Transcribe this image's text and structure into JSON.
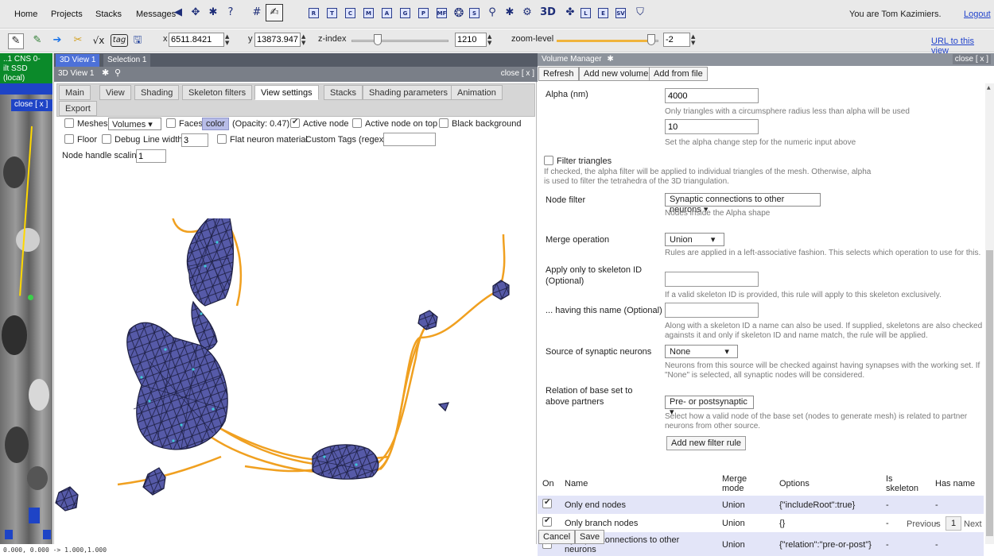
{
  "menu": {
    "items": [
      "Home",
      "Projects",
      "Stacks",
      "Messages"
    ],
    "user_text": "You are Tom Kazimiers.",
    "logout": "Logout"
  },
  "toolbar_icons": [
    "back-icon",
    "navigate-icon",
    "settings-icon",
    "help-icon",
    "grid-icon",
    "tracing-tool-icon"
  ],
  "toolbar_letter_icons": [
    "R",
    "T",
    "C",
    "M",
    "A",
    "G",
    "P",
    "MF",
    "⌘",
    "S",
    "⌕",
    "✱",
    "⚙",
    "3D",
    "⌘",
    "L",
    "E",
    "SV",
    "◇"
  ],
  "toolbar2": {
    "x_label": "x",
    "x_value": "6511.8421",
    "y_label": "y",
    "y_value": "13873.947",
    "z_index_label": "z-index",
    "z_value": "1210",
    "zoom_label": "zoom-level",
    "zoom_value": "-2",
    "url_link": "URL to this view",
    "tag_label": "tag",
    "sqrt_label": "√x"
  },
  "left_strip": {
    "header_line1": "..1 CNS 0-",
    "header_line2": "ilt SSD",
    "header_line3": "(local)",
    "close": "close [ x ]"
  },
  "panel3d": {
    "tabs": [
      "3D View 1",
      "Selection 1"
    ],
    "title": "3D View 1",
    "close": "close [ x ]",
    "view_tabs": [
      "Main",
      "View",
      "Shading",
      "Skeleton filters",
      "View settings",
      "Stacks",
      "Shading parameters",
      "Animation",
      "Export"
    ],
    "active_tab": "View settings",
    "options": {
      "meshes": "Meshes",
      "volumes": "Volumes",
      "faces": "Faces",
      "color": "color",
      "opacity": "(Opacity: 0.47)",
      "active_node": "Active node",
      "active_node_on_top": "Active node on top",
      "black_background": "Black background",
      "floor": "Floor",
      "debug": "Debug",
      "line_width_label": "Line width",
      "line_width_value": "3",
      "flat_neuron_material": "Flat neuron material",
      "custom_tags": "Custom Tags (regex):",
      "node_handle_scaling": "Node handle scaling",
      "node_handle_value": "1"
    },
    "colors": {
      "mesh": "#4a4f9a",
      "mesh_edge": "#1c1e40",
      "skeleton": "#f0a020",
      "synapse": "#3fc8d8"
    }
  },
  "volume_manager": {
    "title": "Volume Manager",
    "close": "close [ x ]",
    "buttons": {
      "refresh": "Refresh",
      "add_volume": "Add new volume",
      "add_file": "Add from file"
    },
    "alpha_label": "Alpha (nm)",
    "alpha_value": "4000",
    "alpha_help": "Only triangles with a circumsphere radius less than alpha will be used",
    "alpha_step_value": "10",
    "alpha_step_help": "Set the alpha change step for the numeric input above",
    "filter_triangles": "Filter triangles",
    "filter_triangles_help": "If checked, the alpha filter will be applied to individual triangles of the mesh. Otherwise, alpha is used to filter the tetrahedra of the 3D triangulation.",
    "node_filter_label": "Node filter",
    "node_filter_value": "Synaptic connections to other neurons",
    "node_filter_help": "Nodes inside the Alpha shape",
    "merge_label": "Merge operation",
    "merge_value": "Union",
    "merge_help": "Rules are applied in a left-associative fashion. This selects which operation to use for this.",
    "skeleton_id_label": "Apply only to skeleton ID (Optional)",
    "skeleton_id_help": "If a valid skeleton ID is provided, this rule will apply to this skeleton exclusively.",
    "name_label": "... having this name (Optional)",
    "name_help": "Along with a skeleton ID a name can also be used. If supplied, skeletons are also checked againsts it and only if skeleton ID and name match, the rule will be applied.",
    "source_label": "Source of synaptic neurons",
    "source_value": "None",
    "source_help": "Neurons from this source will be checked against having synapses with the working set. If \"None\" is selected, all synaptic nodes will be considered.",
    "relation_label": "Relation of base set to above partners",
    "relation_value": "Pre- or postsynaptic",
    "relation_help": "Select how a valid node of the base set (nodes to generate mesh) is related to partner neurons from other source.",
    "add_rule": "Add new filter rule",
    "table": {
      "headers": [
        "On",
        "Name",
        "Merge mode",
        "Options",
        "Is skeleton",
        "Has name"
      ],
      "rows": [
        {
          "name": "Only end nodes",
          "merge": "Union",
          "options": "{\"includeRoot\":true}",
          "is_skeleton": "-",
          "has_name": "-"
        },
        {
          "name": "Only branch nodes",
          "merge": "Union",
          "options": "{}",
          "is_skeleton": "-",
          "has_name": "-"
        },
        {
          "name": "Synaptic connections to other neurons",
          "merge": "Union",
          "options": "{\"relation\":\"pre-or-post\"}",
          "is_skeleton": "-",
          "has_name": "-"
        }
      ]
    },
    "pagination": {
      "previous": "Previous",
      "page": "1",
      "next": "Next"
    },
    "cancel": "Cancel",
    "save": "Save"
  },
  "status_line": "0.000, 0.000 -> 1.000,1.000"
}
